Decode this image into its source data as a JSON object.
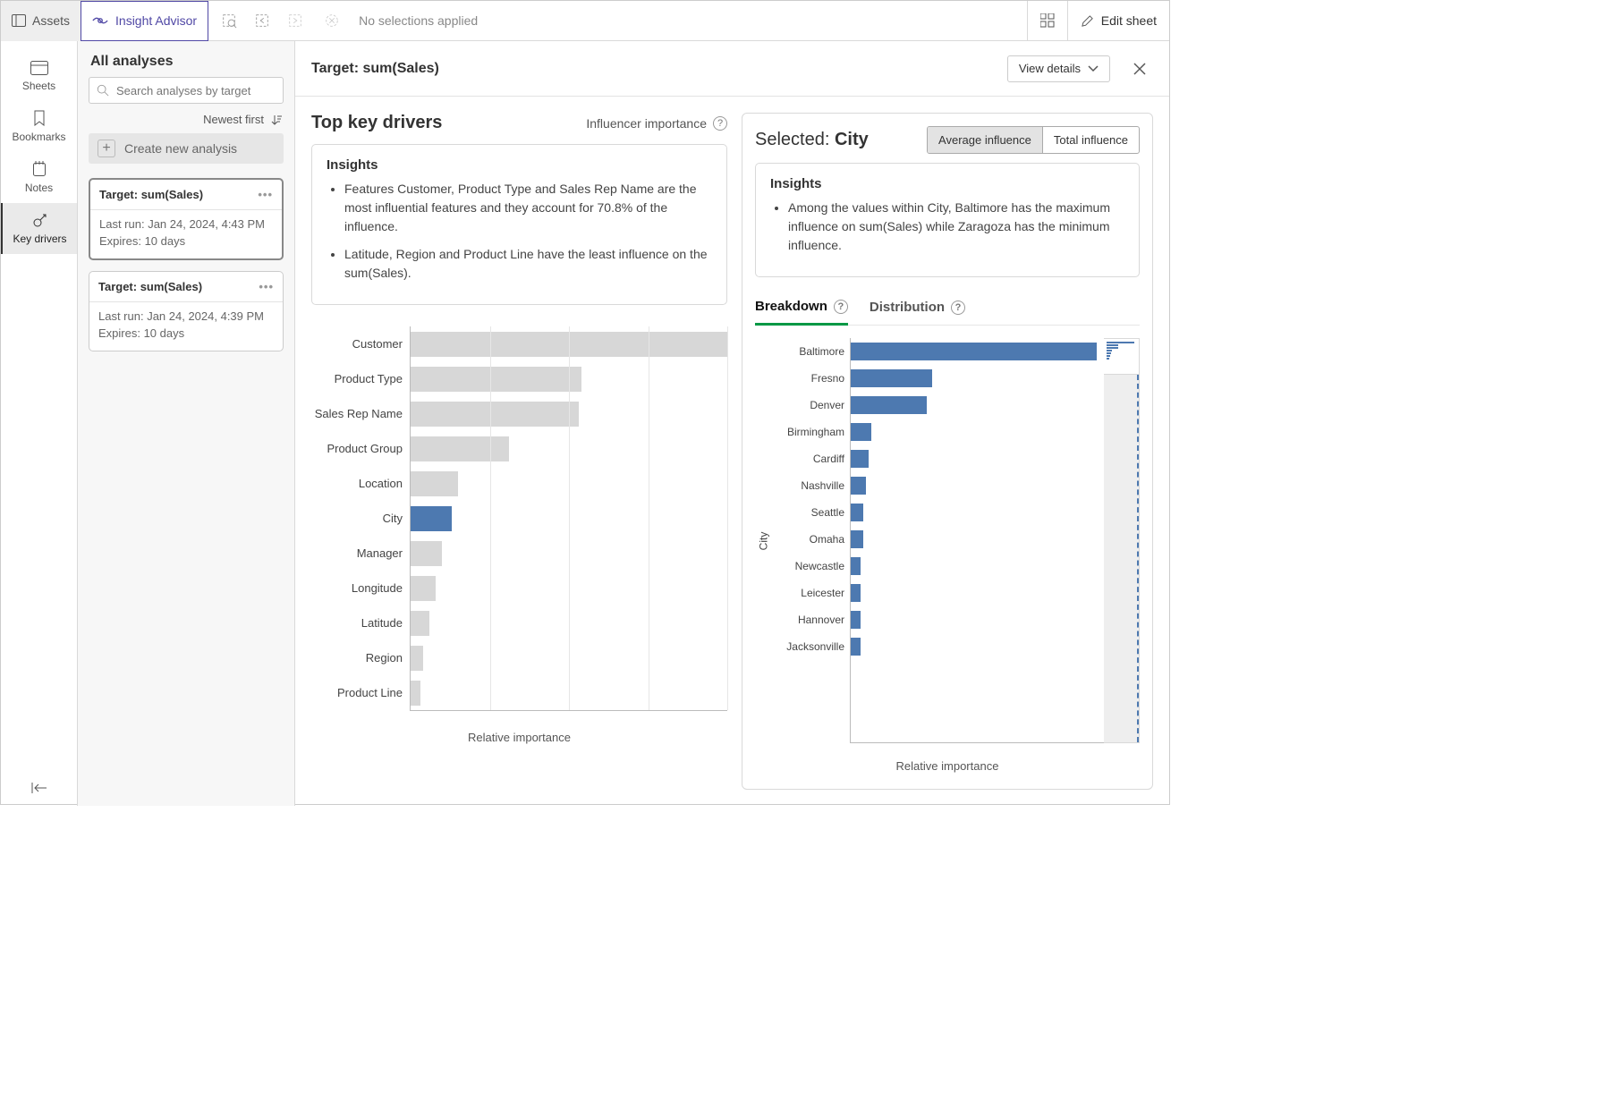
{
  "topbar": {
    "assets": "Assets",
    "insight": "Insight Advisor",
    "no_selections": "No selections applied",
    "edit_sheet": "Edit sheet"
  },
  "rail": {
    "sheets": "Sheets",
    "bookmarks": "Bookmarks",
    "notes": "Notes",
    "key_drivers": "Key drivers"
  },
  "analyses": {
    "title": "All analyses",
    "search_placeholder": "Search analyses by target",
    "sort": "Newest first",
    "create": "Create new analysis",
    "cards": [
      {
        "title": "Target: sum(Sales)",
        "last_run": "Last run: Jan 24, 2024, 4:43 PM",
        "expires": "Expires: 10 days"
      },
      {
        "title": "Target: sum(Sales)",
        "last_run": "Last run: Jan 24, 2024, 4:39 PM",
        "expires": "Expires: 10 days"
      }
    ]
  },
  "detail": {
    "header_title": "Target: sum(Sales)",
    "view_details": "View details",
    "left_title": "Top key drivers",
    "influencer_importance": "Influencer importance",
    "insights_title": "Insights",
    "insights": [
      "Features Customer, Product Type and Sales Rep Name are the most influential features and they account for 70.8% of the influence.",
      "Latitude, Region and Product Line have the least influence on the sum(Sales)."
    ],
    "xlabel_left": "Relative importance"
  },
  "right": {
    "selected_label": "Selected:",
    "selected_value": "City",
    "toggle_avg": "Average influence",
    "toggle_total": "Total influence",
    "insights_title": "Insights",
    "insight": "Among the values within City, Baltimore has the maximum influence on sum(Sales) while Zaragoza has the minimum influence.",
    "tab_breakdown": "Breakdown",
    "tab_distribution": "Distribution",
    "y_label": "City",
    "xlabel": "Relative importance"
  },
  "chart_data": [
    {
      "type": "bar",
      "orientation": "horizontal",
      "title": "Top key drivers",
      "xlabel": "Relative importance",
      "ylabel": "",
      "xlim": [
        0,
        100
      ],
      "categories": [
        "Customer",
        "Product Type",
        "Sales Rep Name",
        "Product Group",
        "Location",
        "City",
        "Manager",
        "Longitude",
        "Latitude",
        "Region",
        "Product Line"
      ],
      "values": [
        100,
        54,
        53,
        31,
        15,
        13,
        10,
        8,
        6,
        4,
        3
      ],
      "highlight": "City",
      "highlight_color": "#4d79b0",
      "bar_color": "#d7d7d7"
    },
    {
      "type": "bar",
      "orientation": "horizontal",
      "title": "Breakdown — City",
      "xlabel": "Relative importance",
      "ylabel": "City",
      "xlim": [
        0,
        100
      ],
      "categories": [
        "Baltimore",
        "Fresno",
        "Denver",
        "Birmingham",
        "Cardiff",
        "Nashville",
        "Seattle",
        "Omaha",
        "Newcastle",
        "Leicester",
        "Hannover",
        "Jacksonville"
      ],
      "values": [
        97,
        32,
        30,
        8,
        7,
        6,
        5,
        5,
        4,
        4,
        4,
        4
      ],
      "bar_color": "#4d79b0"
    }
  ]
}
